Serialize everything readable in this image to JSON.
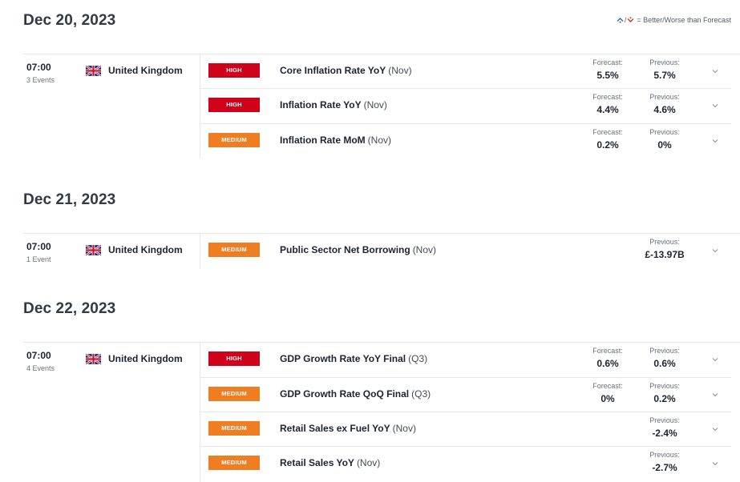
{
  "legend": {
    "text": "= Better/Worse than Forecast",
    "better_icon": "arrow-up-blue",
    "worse_icon": "arrow-down-red",
    "separator": "/"
  },
  "colors": {
    "high": "#d0021b",
    "medium": "#ef7d22",
    "better": "#2b6cb0",
    "worse": "#c0392b"
  },
  "labels": {
    "forecast": "Forecast:",
    "previous": "Previous:"
  },
  "days": [
    {
      "date": "Dec 20, 2023",
      "time": "07:00",
      "count": "3 Events",
      "country": "United Kingdom",
      "events": [
        {
          "impact": "HIGH",
          "name": "Core Inflation Rate YoY",
          "period": "(Nov)",
          "forecast": "5.5%",
          "previous": "5.7%"
        },
        {
          "impact": "HIGH",
          "name": "Inflation Rate YoY",
          "period": "(Nov)",
          "forecast": "4.4%",
          "previous": "4.6%"
        },
        {
          "impact": "MEDIUM",
          "name": "Inflation Rate MoM",
          "period": "(Nov)",
          "forecast": "0.2%",
          "previous": "0%"
        }
      ]
    },
    {
      "date": "Dec 21, 2023",
      "time": "07:00",
      "count": "1 Event",
      "country": "United Kingdom",
      "events": [
        {
          "impact": "MEDIUM",
          "name": "Public Sector Net Borrowing",
          "period": "(Nov)",
          "forecast": null,
          "previous": "£-13.97B"
        }
      ]
    },
    {
      "date": "Dec 22, 2023",
      "time": "07:00",
      "count": "4 Events",
      "country": "United Kingdom",
      "events": [
        {
          "impact": "HIGH",
          "name": "GDP Growth Rate YoY Final",
          "period": "(Q3)",
          "forecast": "0.6%",
          "previous": "0.6%"
        },
        {
          "impact": "MEDIUM",
          "name": "GDP Growth Rate QoQ Final",
          "period": "(Q3)",
          "forecast": "0%",
          "previous": "0.2%"
        },
        {
          "impact": "MEDIUM",
          "name": "Retail Sales ex Fuel YoY",
          "period": "(Nov)",
          "forecast": null,
          "previous": "-2.4%"
        },
        {
          "impact": "MEDIUM",
          "name": "Retail Sales YoY",
          "period": "(Nov)",
          "forecast": null,
          "previous": "-2.7%"
        }
      ]
    }
  ]
}
